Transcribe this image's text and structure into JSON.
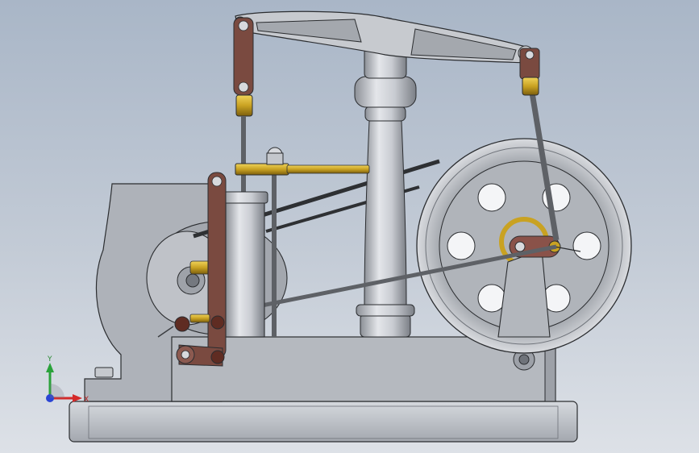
{
  "viewport": {
    "background_top": "#a9b6c7",
    "background_bottom": "#dde1e7"
  },
  "colors": {
    "steel": "#b8bcc4",
    "steel_dark": "#7d8289",
    "outline": "#2b2d30",
    "brass": "#c9a222",
    "link_brown": "#7a4a40",
    "rod": "#5e6166",
    "belt": "#2e3033"
  },
  "triad": {
    "x_label": "X",
    "y_label": "Y",
    "x_color": "#d42a2a",
    "y_color": "#2aa23a",
    "z_color": "#2a44d4"
  }
}
